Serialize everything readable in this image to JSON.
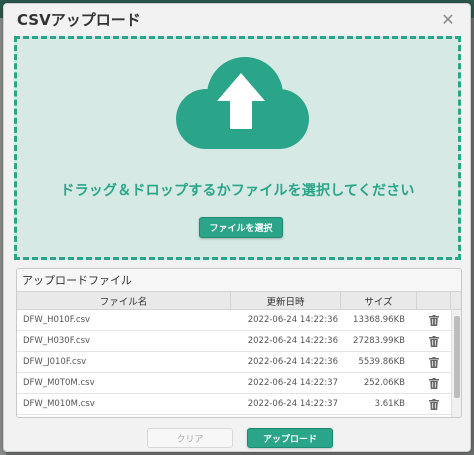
{
  "dialog": {
    "title": "CSVアップロード",
    "close_icon": "close-icon"
  },
  "dropzone": {
    "icon": "cloud-upload-icon",
    "message": "ドラッグ＆ドロップするかファイルを選択してください",
    "select_button": "ファイルを選択"
  },
  "file_panel": {
    "title": "アップロードファイル",
    "columns": [
      "ファイル名",
      "更新日時",
      "サイズ",
      ""
    ],
    "rows": [
      {
        "name": "DFW_H010F.csv",
        "date": "2022-06-24 14:22:36",
        "size": "13368.96KB"
      },
      {
        "name": "DFW_H030F.csv",
        "date": "2022-06-24 14:22:36",
        "size": "27283.99KB"
      },
      {
        "name": "DFW_J010F.csv",
        "date": "2022-06-24 14:22:36",
        "size": "5539.86KB"
      },
      {
        "name": "DFW_M0T0M.csv",
        "date": "2022-06-24 14:22:37",
        "size": "252.06KB"
      },
      {
        "name": "DFW_M010M.csv",
        "date": "2022-06-24 14:22:37",
        "size": "3.61KB"
      }
    ]
  },
  "footer": {
    "clear_label": "クリア",
    "upload_label": "アップロード"
  },
  "colors": {
    "accent": "#2aa58a",
    "dropzone_bg": "#d6e9e4"
  }
}
